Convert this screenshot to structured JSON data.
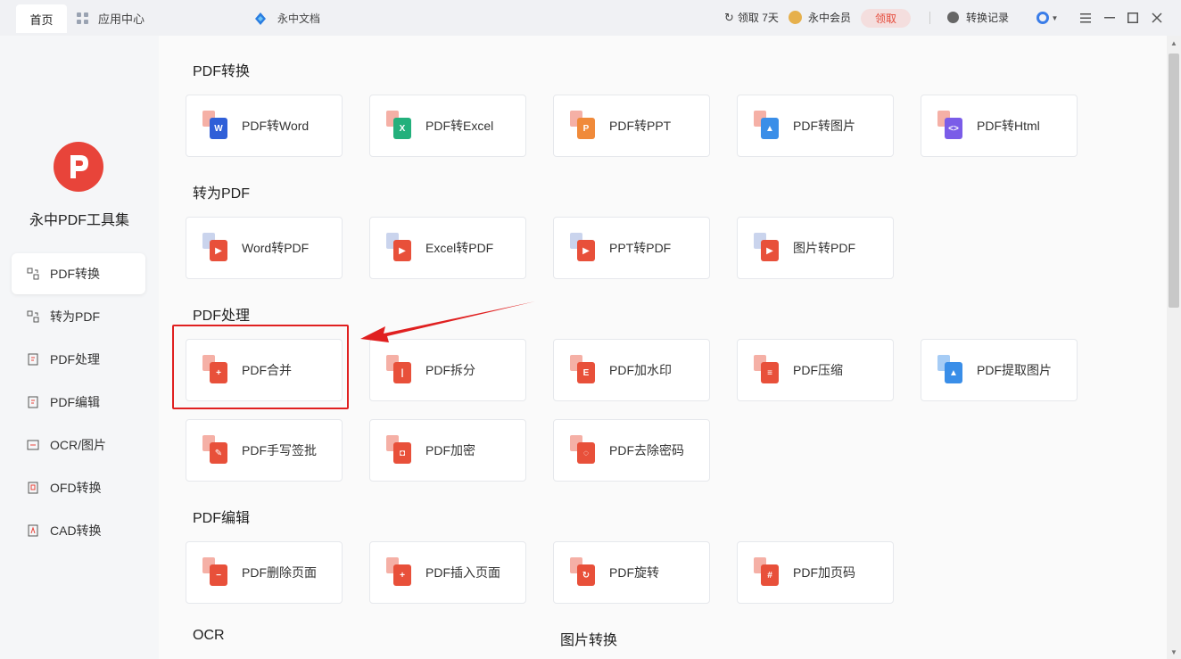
{
  "topbar": {
    "tab_home": "首页",
    "tab_apps": "应用中心",
    "brand_doc": "永中文档",
    "claim_days": "领取 7天",
    "member": "永中会员",
    "claim_button": "领取",
    "history": "转换记录"
  },
  "sidebar": {
    "app_name": "永中PDF工具集",
    "items": [
      {
        "label": "PDF转换",
        "active": true
      },
      {
        "label": "转为PDF",
        "active": false
      },
      {
        "label": "PDF处理",
        "active": false
      },
      {
        "label": "PDF编辑",
        "active": false
      },
      {
        "label": "OCR/图片",
        "active": false
      },
      {
        "label": "OFD转换",
        "active": false
      },
      {
        "label": "CAD转换",
        "active": false
      }
    ]
  },
  "sections": [
    {
      "title": "PDF转换",
      "tools": [
        {
          "label": "PDF转Word",
          "color": "#2f5fd8",
          "glyph": "W"
        },
        {
          "label": "PDF转Excel",
          "color": "#23b07c",
          "glyph": "X"
        },
        {
          "label": "PDF转PPT",
          "color": "#f08a3a",
          "glyph": "P"
        },
        {
          "label": "PDF转图片",
          "color": "#3a8ee8",
          "glyph": "▲"
        },
        {
          "label": "PDF转Html",
          "color": "#7a5ce8",
          "glyph": "<>"
        }
      ]
    },
    {
      "title": "转为PDF",
      "tools": [
        {
          "label": "Word转PDF",
          "color": "#e8503a",
          "glyph": "▶"
        },
        {
          "label": "Excel转PDF",
          "color": "#e8503a",
          "glyph": "▶"
        },
        {
          "label": "PPT转PDF",
          "color": "#e8503a",
          "glyph": "▶"
        },
        {
          "label": "图片转PDF",
          "color": "#e8503a",
          "glyph": "▶"
        }
      ]
    },
    {
      "title": "PDF处理",
      "tools": [
        {
          "label": "PDF合并",
          "color": "#e8503a",
          "glyph": "+"
        },
        {
          "label": "PDF拆分",
          "color": "#e8503a",
          "glyph": "|"
        },
        {
          "label": "PDF加水印",
          "color": "#e8503a",
          "glyph": "E"
        },
        {
          "label": "PDF压缩",
          "color": "#e8503a",
          "glyph": "≡"
        },
        {
          "label": "PDF提取图片",
          "color": "#3a8ee8",
          "glyph": "▲"
        },
        {
          "label": "PDF手写签批",
          "color": "#e8503a",
          "glyph": "✎"
        },
        {
          "label": "PDF加密",
          "color": "#e8503a",
          "glyph": "◘"
        },
        {
          "label": "PDF去除密码",
          "color": "#e8503a",
          "glyph": "◌"
        }
      ]
    },
    {
      "title": "PDF编辑",
      "tools": [
        {
          "label": "PDF删除页面",
          "color": "#e8503a",
          "glyph": "−"
        },
        {
          "label": "PDF插入页面",
          "color": "#e8503a",
          "glyph": "+"
        },
        {
          "label": "PDF旋转",
          "color": "#e8503a",
          "glyph": "↻"
        },
        {
          "label": "PDF加页码",
          "color": "#e8503a",
          "glyph": "#"
        }
      ]
    }
  ],
  "bottom_sections": [
    "OCR",
    "图片转换"
  ]
}
